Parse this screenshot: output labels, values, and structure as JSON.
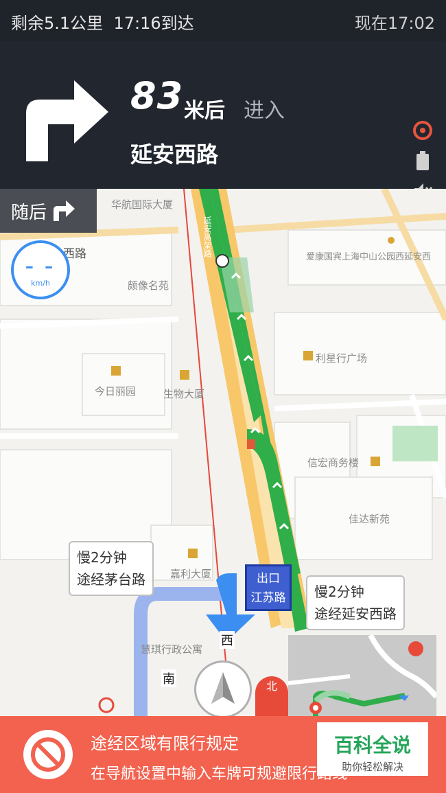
{
  "status": {
    "remaining": "剩余5.1公里",
    "arrival": "17:16到达",
    "now": "现在17:02"
  },
  "nav": {
    "distance": "83",
    "unit": "米后",
    "action": "进入",
    "road": "延安西路"
  },
  "followup": {
    "label": "随后"
  },
  "speed": {
    "value": "– –",
    "unit": "km/h"
  },
  "map": {
    "pois": [
      "华航国际大厦",
      "西路",
      "颇像名苑",
      "今日丽园",
      "生物大厦",
      "利星行广场",
      "信宏商务楼",
      "佳达新苑",
      "嘉利大厦",
      "慧琪行政公寓",
      "爱康国宾上海中山公园西延安西",
      "延安高架路"
    ],
    "route_options": [
      {
        "time": "慢2分钟",
        "via": "途经茅台路"
      },
      {
        "time": "慢2分钟",
        "via": "途经延安西路"
      }
    ],
    "exit_sign": {
      "top": "出口",
      "road": "江苏路"
    },
    "direction_labels": {
      "west": "西",
      "south": "南",
      "north": "北"
    }
  },
  "banner": {
    "line1": "途经区域有限行规定",
    "line2": "在导航设置中输入车牌可规避限行路线"
  },
  "watermark": {
    "title": "百科全说",
    "subtitle": "助你轻松解决"
  },
  "colors": {
    "route": "#2fae4a",
    "highway": "#f7c76a",
    "banner": "#f2624f",
    "accent": "#3c8ff0"
  }
}
